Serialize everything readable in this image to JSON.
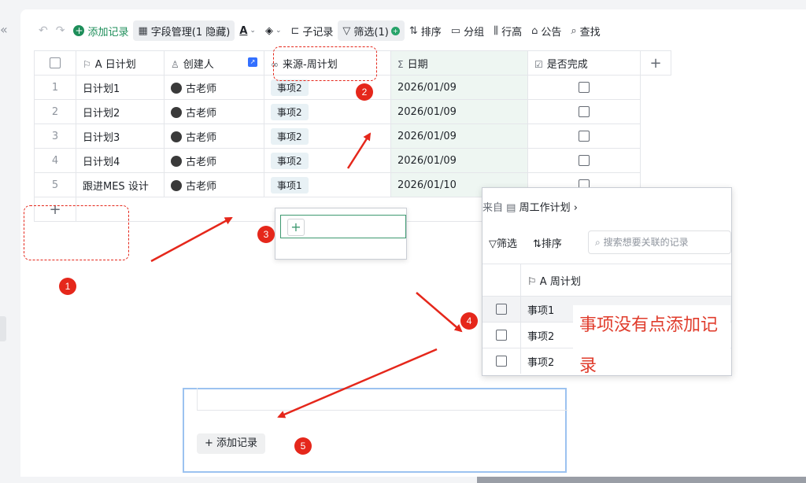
{
  "toolbar": {
    "undo": "↶",
    "redo": "↷",
    "add_record": "添加记录",
    "field_manage": "字段管理(1 隐藏)",
    "text_color": "A",
    "fill": "◈",
    "sub_record": "子记录",
    "filter": "筛选(1)",
    "sort": "排序",
    "group": "分组",
    "row_height": "行高",
    "notice": "公告",
    "find": "查找"
  },
  "table": {
    "headers": {
      "plan": "A 日计划",
      "creator": "创建人",
      "source": "来源-周计划",
      "date": "日期",
      "done": "是否完成",
      "add": "+"
    },
    "rows": [
      {
        "idx": "1",
        "plan": "日计划1",
        "creator": "古老师",
        "source": "事项2",
        "date": "2026/01/09"
      },
      {
        "idx": "2",
        "plan": "日计划2",
        "creator": "古老师",
        "source": "事项2",
        "date": "2026/01/09"
      },
      {
        "idx": "3",
        "plan": "日计划3",
        "creator": "古老师",
        "source": "事项2",
        "date": "2026/01/09"
      },
      {
        "idx": "4",
        "plan": "日计划4",
        "creator": "古老师",
        "source": "事项2",
        "date": "2026/01/09"
      },
      {
        "idx": "5",
        "plan": "跟进MES 设计",
        "creator": "古老师",
        "source": "事项1",
        "date": "2026/01/10"
      }
    ],
    "add_row": "+"
  },
  "popup_link": {
    "crumb_prefix": "来自",
    "crumb_table": "周工作计划 ›",
    "filter": "筛选",
    "sort": "排序",
    "search_placeholder": "搜索想要关联的记录",
    "col_header": "A 周计划",
    "items": [
      "事项1",
      "事项2",
      "事项2"
    ]
  },
  "popup_small": {
    "plus": "+"
  },
  "popup_bottom": {
    "add_record": "+ 添加记录"
  },
  "annotation": {
    "note": "事项没有点添加记录",
    "markers": [
      "1",
      "2",
      "3",
      "4",
      "5"
    ]
  },
  "colors": {
    "accent": "#1e8e5a",
    "annotation_red": "#e5271b",
    "date_column_bg": "#eef6f2"
  }
}
